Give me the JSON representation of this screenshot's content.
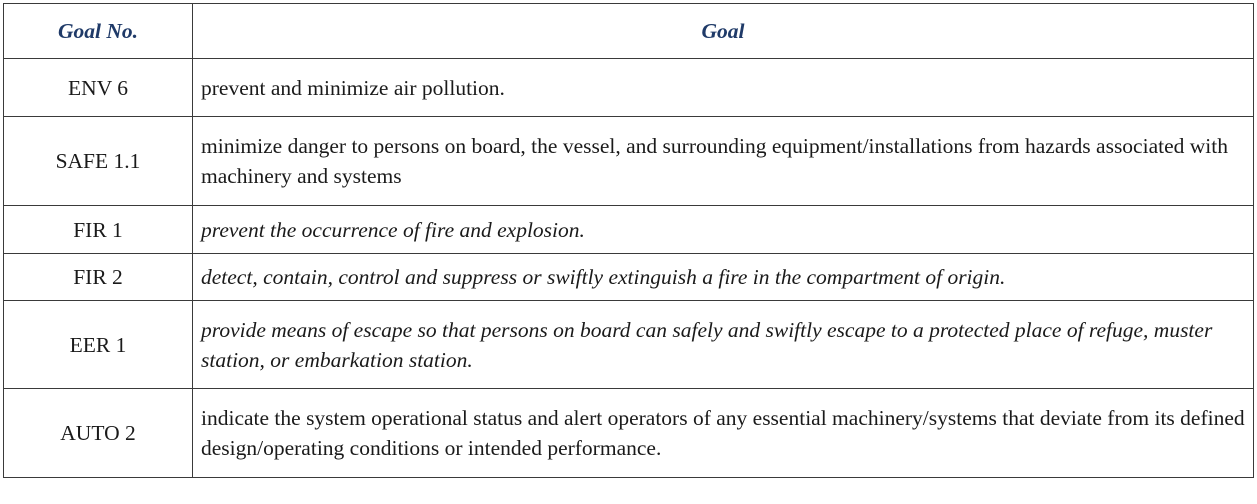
{
  "table": {
    "headers": {
      "goal_no": "Goal No.",
      "goal": "Goal"
    },
    "rows": [
      {
        "goal_no": "ENV 6",
        "goal": "prevent and minimize air pollution.",
        "italic": false
      },
      {
        "goal_no": "SAFE 1.1",
        "goal": "minimize danger to persons on board, the vessel, and surrounding equipment/installations from hazards associated with machinery and systems",
        "italic": false
      },
      {
        "goal_no": "FIR 1",
        "goal": "prevent the occurrence of fire and explosion.",
        "italic": true
      },
      {
        "goal_no": "FIR 2",
        "goal": "detect, contain, control and suppress or swiftly extinguish a fire in the compartment of origin.",
        "italic": true
      },
      {
        "goal_no": "EER 1",
        "goal": "provide means of escape so that persons on board can safely and swiftly escape to a protected place of refuge, muster station, or embarkation station.",
        "italic": true
      },
      {
        "goal_no": "AUTO 2",
        "goal": "indicate the system operational status and alert operators of any essential machinery/systems that deviate from its defined design/operating conditions or intended performance.",
        "italic": false
      }
    ]
  },
  "colors": {
    "header_text": "#1f3a68",
    "border": "#3a3a3a",
    "body_text": "#1a1a1a"
  }
}
